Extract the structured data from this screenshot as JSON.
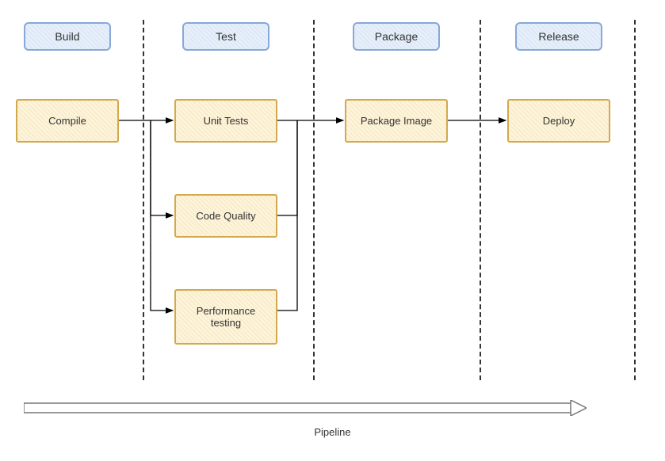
{
  "chart_data": {
    "type": "diagram",
    "title": "Pipeline",
    "stages": [
      {
        "name": "Build",
        "tasks": [
          "Compile"
        ]
      },
      {
        "name": "Test",
        "tasks": [
          "Unit Tests",
          "Code Quality",
          "Performance testing"
        ]
      },
      {
        "name": "Package",
        "tasks": [
          "Package Image"
        ]
      },
      {
        "name": "Release",
        "tasks": [
          "Deploy"
        ]
      }
    ],
    "flow": [
      {
        "from": "Compile",
        "to": "Unit Tests"
      },
      {
        "from": "Compile",
        "to": "Code Quality"
      },
      {
        "from": "Compile",
        "to": "Performance testing"
      },
      {
        "from": "Unit Tests",
        "to": "Package Image"
      },
      {
        "from": "Code Quality",
        "to": "Package Image"
      },
      {
        "from": "Performance testing",
        "to": "Package Image"
      },
      {
        "from": "Package Image",
        "to": "Deploy"
      }
    ]
  },
  "headers": {
    "build": "Build",
    "test": "Test",
    "package": "Package",
    "release": "Release"
  },
  "tasks": {
    "compile": "Compile",
    "unit_tests": "Unit Tests",
    "code_quality": "Code Quality",
    "perf_testing": "Performance testing",
    "package_image": "Package Image",
    "deploy": "Deploy"
  },
  "footer": {
    "label": "Pipeline"
  }
}
